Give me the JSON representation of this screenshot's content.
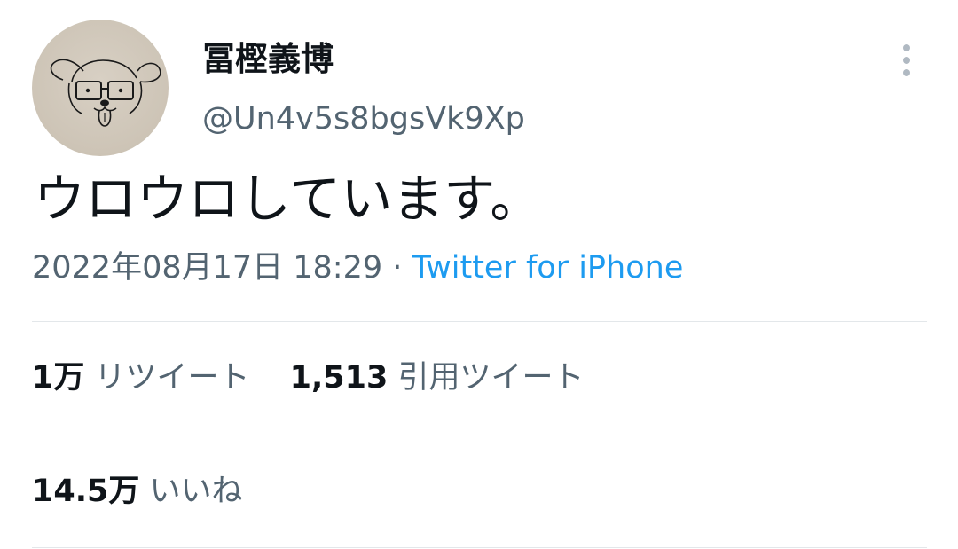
{
  "tweet": {
    "author": {
      "display_name": "冨樫義博",
      "handle": "@Un4v5s8bgsVk9Xp",
      "avatar_icon": "dog-face-drawing-avatar"
    },
    "text": "ウロウロしています。",
    "timestamp": "2022年08月17日 18:29",
    "separator": " · ",
    "source": "Twitter for iPhone",
    "more_icon": "vertical-ellipsis-icon"
  },
  "stats": {
    "retweets": {
      "count": "1万",
      "label": "リツイート"
    },
    "quotes": {
      "count": "1,513",
      "label": "引用ツイート"
    },
    "likes": {
      "count": "14.5万",
      "label": "いいね"
    }
  },
  "colors": {
    "text_primary": "#0f1419",
    "text_secondary": "#536471",
    "link": "#1d9bf0",
    "divider": "#e3e7ea"
  }
}
